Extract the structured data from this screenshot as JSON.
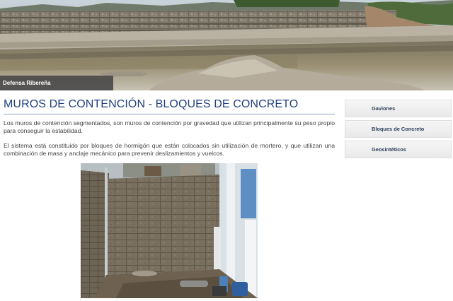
{
  "banner": {
    "caption": "Defensa Ribereña"
  },
  "main": {
    "title": "MUROS DE CONTENCIÓN - BLOQUES DE CONCRETO",
    "paragraphs": [
      "Los muros de contención segmentados, son muros de contención por gravedad que utilizan principalmente su peso propio para conseguir la estabilidad.",
      "El sistema está constituido por bloques de hormigón que están colocados sin utilización de mortero, y que utilizan una combinación de masa y anclaje mecánico para prevenir deslizamientos y vuelcos."
    ]
  },
  "sidebar": {
    "items": [
      {
        "label": "Gaviones"
      },
      {
        "label": "Bloques de Concreto"
      },
      {
        "label": "Geosintéticos"
      }
    ]
  },
  "colors": {
    "title": "#1f3f80",
    "sidebar_bg": "#efefef",
    "caption_bg": "#464646"
  }
}
